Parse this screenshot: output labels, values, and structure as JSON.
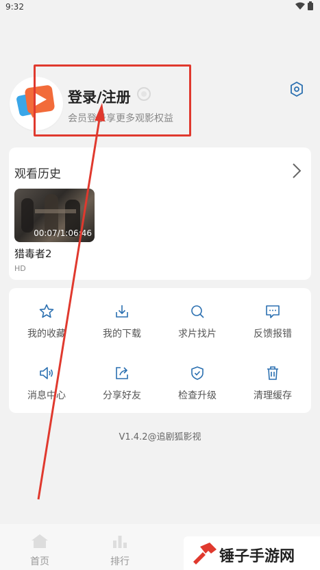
{
  "status": {
    "time": "9:32"
  },
  "profile": {
    "title": "登录/注册",
    "subtitle": "会员登录享更多观影权益",
    "icons": [
      "app-logo-icon",
      "member-badge-icon",
      "settings-icon"
    ]
  },
  "history": {
    "title": "观看历史",
    "items": [
      {
        "title": "猎毒者2",
        "quality": "HD",
        "progress": "00:07/1:06:46"
      }
    ]
  },
  "menu": {
    "items": [
      {
        "label": "我的收藏",
        "icon": "star-icon"
      },
      {
        "label": "我的下载",
        "icon": "download-icon"
      },
      {
        "label": "求片找片",
        "icon": "search-icon"
      },
      {
        "label": "反馈报错",
        "icon": "feedback-icon"
      },
      {
        "label": "消息中心",
        "icon": "speaker-icon"
      },
      {
        "label": "分享好友",
        "icon": "share-icon"
      },
      {
        "label": "检查升级",
        "icon": "shield-icon"
      },
      {
        "label": "清理缓存",
        "icon": "trash-icon"
      }
    ]
  },
  "version": "V1.4.2@追剧狐影视",
  "bottom_nav": {
    "items": [
      {
        "label": "首页"
      },
      {
        "label": "排行"
      }
    ]
  },
  "watermark": {
    "text": "锤子手游网"
  },
  "colors": {
    "accent": "#1a8fd6",
    "annotation": "#e0392e",
    "logo_orange": "#f26b3a"
  }
}
